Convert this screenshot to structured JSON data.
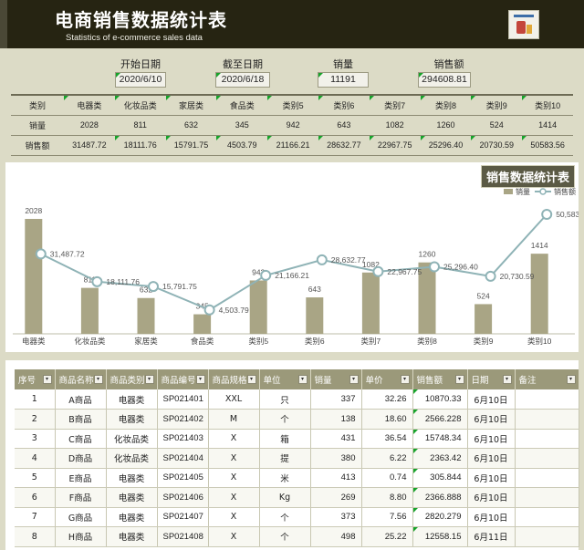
{
  "header": {
    "title": "电商销售数据统计表",
    "subtitle": "Statistics of e-commerce sales data",
    "logo_icon": "report-doc-icon"
  },
  "summary": {
    "start_label": "开始日期",
    "start_value": "2020/6/10",
    "end_label": "截至日期",
    "end_value": "2020/6/18",
    "qty_label": "销量",
    "qty_value": "11191",
    "amount_label": "销售额",
    "amount_value": "294608.81"
  },
  "category_table": {
    "row_labels": [
      "类别",
      "销量",
      "销售额"
    ],
    "categories": [
      "电器类",
      "化妆品类",
      "家居类",
      "食品类",
      "类别5",
      "类别6",
      "类别7",
      "类别8",
      "类别9",
      "类别10"
    ],
    "qty_strings": [
      "2028",
      "811",
      "632",
      "345",
      "942",
      "643",
      "1082",
      "1260",
      "524",
      "1414"
    ],
    "amount_strings": [
      "31487.72",
      "18111.76",
      "15791.75",
      "4503.79",
      "21166.21",
      "28632.77",
      "22967.75",
      "25296.40",
      "20730.59",
      "50583.56"
    ]
  },
  "chart_data": {
    "type": "bar",
    "title": "销售数据统计表",
    "legend_placement": "top-right",
    "grid": false,
    "categories": [
      "电器类",
      "化妆品类",
      "家居类",
      "食品类",
      "类别5",
      "类别6",
      "类别7",
      "类别8",
      "类别9",
      "类别10"
    ],
    "series": [
      {
        "name": "销量",
        "kind": "bar",
        "color": "#a9a585",
        "values": [
          2028,
          811,
          632,
          345,
          942,
          643,
          1082,
          1260,
          524,
          1414
        ],
        "labels": [
          "2028",
          "811",
          "632",
          "345",
          "942",
          "643",
          "1082",
          "1260",
          "524",
          "1414"
        ]
      },
      {
        "name": "销售额",
        "kind": "line",
        "color": "#8fb3b6",
        "values": [
          31487.72,
          18111.76,
          15791.75,
          4503.79,
          21166.21,
          28632.77,
          22967.75,
          25296.4,
          20730.59,
          50583.56
        ],
        "labels": [
          "31,487.72",
          "18,111.76",
          "15,791.75",
          "4,503.79",
          "21,166.21",
          "28,632.77",
          "22,967.75",
          "25,296.40",
          "20,730.59",
          "50,583.56"
        ]
      }
    ]
  },
  "orders": {
    "columns": [
      "序号",
      "商品名称",
      "商品类别",
      "商品编号",
      "商品规格",
      "单位",
      "销量",
      "单价",
      "销售额",
      "日期",
      "备注"
    ],
    "rows": [
      [
        "1",
        "A商品",
        "电器类",
        "SP021401",
        "XXL",
        "只",
        "337",
        "32.26",
        "10870.33",
        "6月10日",
        ""
      ],
      [
        "2",
        "B商品",
        "电器类",
        "SP021402",
        "M",
        "个",
        "138",
        "18.60",
        "2566.228",
        "6月10日",
        ""
      ],
      [
        "3",
        "C商品",
        "化妆品类",
        "SP021403",
        "X",
        "箱",
        "431",
        "36.54",
        "15748.34",
        "6月10日",
        ""
      ],
      [
        "4",
        "D商品",
        "化妆品类",
        "SP021404",
        "X",
        "提",
        "380",
        "6.22",
        "2363.42",
        "6月10日",
        ""
      ],
      [
        "5",
        "E商品",
        "电器类",
        "SP021405",
        "X",
        "米",
        "413",
        "0.74",
        "305.844",
        "6月10日",
        ""
      ],
      [
        "6",
        "F商品",
        "电器类",
        "SP021406",
        "X",
        "Kg",
        "269",
        "8.80",
        "2366.888",
        "6月10日",
        ""
      ],
      [
        "7",
        "G商品",
        "电器类",
        "SP021407",
        "X",
        "个",
        "373",
        "7.56",
        "2820.279",
        "6月10日",
        ""
      ],
      [
        "8",
        "H商品",
        "电器类",
        "SP021408",
        "X",
        "个",
        "498",
        "25.22",
        "12558.15",
        "6月11日",
        ""
      ]
    ]
  },
  "colors": {
    "header_bg": "#262412",
    "page_bg": "#dcdbc6",
    "table_head": "#9b997a",
    "bar": "#a9a585",
    "line": "#8fb3b6"
  }
}
